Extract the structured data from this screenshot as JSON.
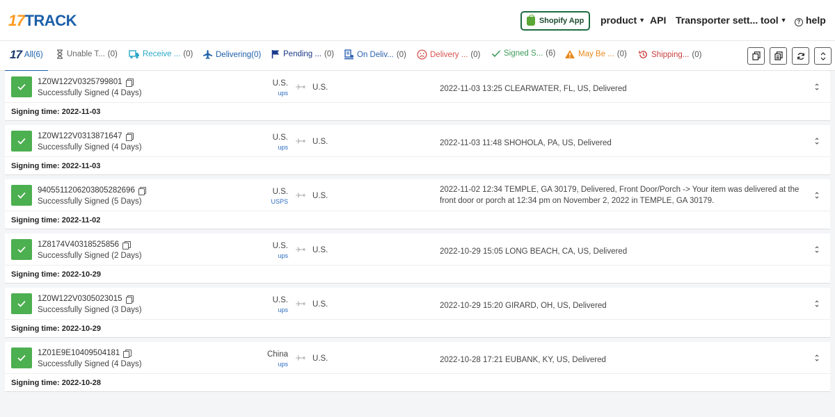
{
  "header": {
    "logo_num": "17",
    "logo_text": "TRACK",
    "shopify_label": "Shopify App",
    "nav": {
      "product": "product",
      "api": "API",
      "transporter": "Transporter sett...",
      "tool": "tool",
      "help": "help"
    }
  },
  "tabs": {
    "all": {
      "icon_text": "17",
      "label": "All",
      "count": "(6)"
    },
    "unable": {
      "label": "Unable T...",
      "count": "(0)"
    },
    "receive": {
      "label": "Receive ...",
      "count": "(0)"
    },
    "delivering": {
      "label": "Delivering",
      "count": "(0)"
    },
    "pending": {
      "label": "Pending ...",
      "count": "(0)"
    },
    "on_delivery": {
      "label": "On Deliv...",
      "count": "(0)"
    },
    "delivery_fail": {
      "label": "Delivery ...",
      "count": "(0)"
    },
    "signed": {
      "label": "Signed S...",
      "count": "(6)"
    },
    "may_be": {
      "label": "May Be ...",
      "count": "(0)"
    },
    "shipping": {
      "label": "Shipping...",
      "count": "(0)"
    }
  },
  "colors": {
    "brand_blue": "#1b5fa9",
    "brand_orange": "#ff9a1f",
    "success_green": "#4caf50",
    "receive_teal": "#2aa7c9",
    "fail_red": "#d9534f",
    "warn_orange": "#e8891a",
    "shipping_red": "#c94040"
  },
  "shipments": [
    {
      "tracking": "1Z0W122V0325799801",
      "status": "Successfully Signed (4 Days)",
      "origin": "U.S.",
      "carrier": "ups",
      "destination": "U.S.",
      "event": "2022-11-03 13:25  CLEARWATER, FL, US, Delivered",
      "signing": "Signing time: 2022-11-03"
    },
    {
      "tracking": "1Z0W122V0313871647",
      "status": "Successfully Signed (4 Days)",
      "origin": "U.S.",
      "carrier": "ups",
      "destination": "U.S.",
      "event": "2022-11-03 11:48  SHOHOLA, PA, US, Delivered",
      "signing": "Signing time: 2022-11-03"
    },
    {
      "tracking": "9405511206203805282696",
      "status": "Successfully Signed (5 Days)",
      "origin": "U.S.",
      "carrier": "USPS",
      "destination": "U.S.",
      "event": "2022-11-02 12:34  TEMPLE, GA 30179, Delivered, Front Door/Porch -> Your item was delivered at the front door or porch at 12:34 pm on November 2, 2022 in TEMPLE, GA 30179.",
      "signing": "Signing time: 2022-11-02"
    },
    {
      "tracking": "1Z8174V40318525856",
      "status": "Successfully Signed (2 Days)",
      "origin": "U.S.",
      "carrier": "ups",
      "destination": "U.S.",
      "event": "2022-10-29 15:05  LONG BEACH, CA, US, Delivered",
      "signing": "Signing time: 2022-10-29"
    },
    {
      "tracking": "1Z0W122V0305023015",
      "status": "Successfully Signed (3 Days)",
      "origin": "U.S.",
      "carrier": "ups",
      "destination": "U.S.",
      "event": "2022-10-29 15:20  GIRARD, OH, US, Delivered",
      "signing": "Signing time: 2022-10-29"
    },
    {
      "tracking": "1Z01E9E10409504181",
      "status": "Successfully Signed (4 Days)",
      "origin": "China",
      "carrier": "ups",
      "destination": "U.S.",
      "event": "2022-10-28 17:21  EUBANK, KY, US, Delivered",
      "signing": "Signing time: 2022-10-28"
    }
  ]
}
